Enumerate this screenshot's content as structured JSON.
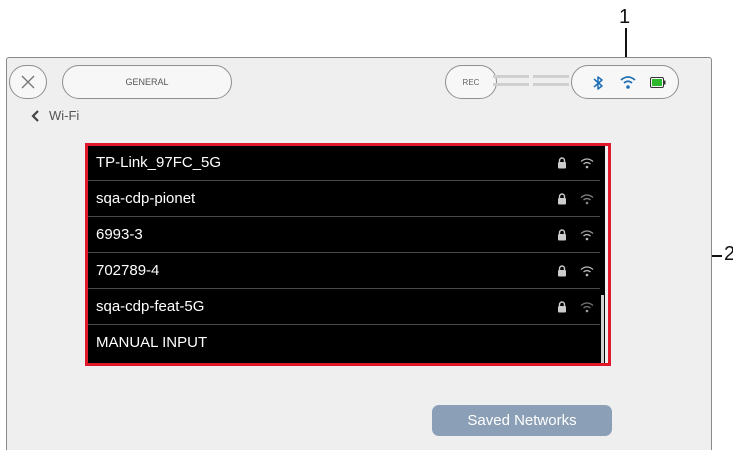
{
  "callouts": {
    "one": "1",
    "two": "2"
  },
  "header": {
    "tab_label": "GENERAL",
    "rec_label": "REC",
    "status_icons": [
      "bluetooth-icon",
      "wifi-icon",
      "battery-icon"
    ]
  },
  "breadcrumb": {
    "label": "Wi-Fi"
  },
  "networks": [
    {
      "name": "TP-Link_97FC_5G",
      "secured": true
    },
    {
      "name": "sqa-cdp-pionet",
      "secured": true
    },
    {
      "name": "6993-3",
      "secured": true
    },
    {
      "name": "702789-4",
      "secured": true
    },
    {
      "name": "sqa-cdp-feat-5G",
      "secured": true
    },
    {
      "name": "MANUAL INPUT",
      "secured": false
    }
  ],
  "footer": {
    "saved_networks_label": "Saved Networks"
  },
  "colors": {
    "accent_button": "#8b9fb6",
    "callout_box": "#e0192a",
    "list_background": "#000000",
    "battery": "#2eb82e",
    "bluetooth": "#1f6fb5"
  }
}
